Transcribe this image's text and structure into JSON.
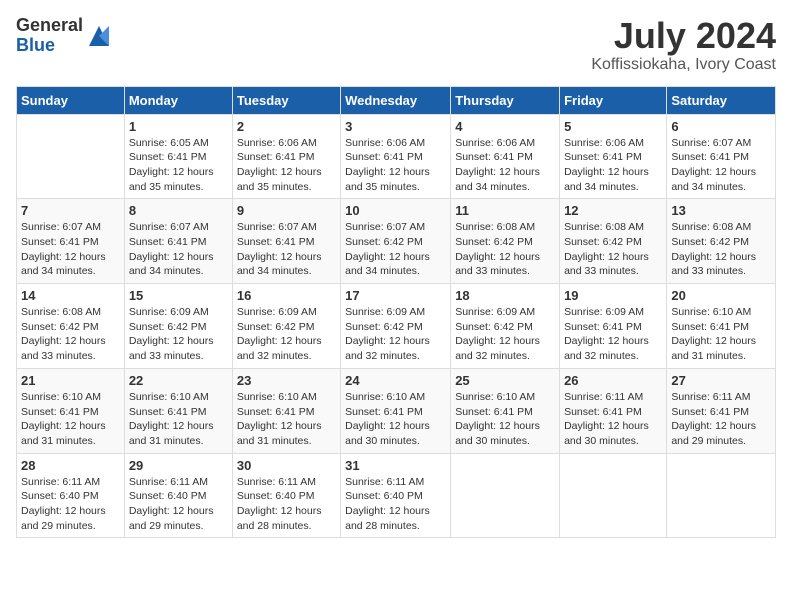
{
  "logo": {
    "general": "General",
    "blue": "Blue"
  },
  "title": {
    "month_year": "July 2024",
    "location": "Koffissiokaha, Ivory Coast"
  },
  "days_header": [
    "Sunday",
    "Monday",
    "Tuesday",
    "Wednesday",
    "Thursday",
    "Friday",
    "Saturday"
  ],
  "weeks": [
    [
      {
        "day": "",
        "sunrise": "",
        "sunset": "",
        "daylight": ""
      },
      {
        "day": "1",
        "sunrise": "Sunrise: 6:05 AM",
        "sunset": "Sunset: 6:41 PM",
        "daylight": "Daylight: 12 hours and 35 minutes."
      },
      {
        "day": "2",
        "sunrise": "Sunrise: 6:06 AM",
        "sunset": "Sunset: 6:41 PM",
        "daylight": "Daylight: 12 hours and 35 minutes."
      },
      {
        "day": "3",
        "sunrise": "Sunrise: 6:06 AM",
        "sunset": "Sunset: 6:41 PM",
        "daylight": "Daylight: 12 hours and 35 minutes."
      },
      {
        "day": "4",
        "sunrise": "Sunrise: 6:06 AM",
        "sunset": "Sunset: 6:41 PM",
        "daylight": "Daylight: 12 hours and 34 minutes."
      },
      {
        "day": "5",
        "sunrise": "Sunrise: 6:06 AM",
        "sunset": "Sunset: 6:41 PM",
        "daylight": "Daylight: 12 hours and 34 minutes."
      },
      {
        "day": "6",
        "sunrise": "Sunrise: 6:07 AM",
        "sunset": "Sunset: 6:41 PM",
        "daylight": "Daylight: 12 hours and 34 minutes."
      }
    ],
    [
      {
        "day": "7",
        "sunrise": "Sunrise: 6:07 AM",
        "sunset": "Sunset: 6:41 PM",
        "daylight": "Daylight: 12 hours and 34 minutes."
      },
      {
        "day": "8",
        "sunrise": "Sunrise: 6:07 AM",
        "sunset": "Sunset: 6:41 PM",
        "daylight": "Daylight: 12 hours and 34 minutes."
      },
      {
        "day": "9",
        "sunrise": "Sunrise: 6:07 AM",
        "sunset": "Sunset: 6:41 PM",
        "daylight": "Daylight: 12 hours and 34 minutes."
      },
      {
        "day": "10",
        "sunrise": "Sunrise: 6:07 AM",
        "sunset": "Sunset: 6:42 PM",
        "daylight": "Daylight: 12 hours and 34 minutes."
      },
      {
        "day": "11",
        "sunrise": "Sunrise: 6:08 AM",
        "sunset": "Sunset: 6:42 PM",
        "daylight": "Daylight: 12 hours and 33 minutes."
      },
      {
        "day": "12",
        "sunrise": "Sunrise: 6:08 AM",
        "sunset": "Sunset: 6:42 PM",
        "daylight": "Daylight: 12 hours and 33 minutes."
      },
      {
        "day": "13",
        "sunrise": "Sunrise: 6:08 AM",
        "sunset": "Sunset: 6:42 PM",
        "daylight": "Daylight: 12 hours and 33 minutes."
      }
    ],
    [
      {
        "day": "14",
        "sunrise": "Sunrise: 6:08 AM",
        "sunset": "Sunset: 6:42 PM",
        "daylight": "Daylight: 12 hours and 33 minutes."
      },
      {
        "day": "15",
        "sunrise": "Sunrise: 6:09 AM",
        "sunset": "Sunset: 6:42 PM",
        "daylight": "Daylight: 12 hours and 33 minutes."
      },
      {
        "day": "16",
        "sunrise": "Sunrise: 6:09 AM",
        "sunset": "Sunset: 6:42 PM",
        "daylight": "Daylight: 12 hours and 32 minutes."
      },
      {
        "day": "17",
        "sunrise": "Sunrise: 6:09 AM",
        "sunset": "Sunset: 6:42 PM",
        "daylight": "Daylight: 12 hours and 32 minutes."
      },
      {
        "day": "18",
        "sunrise": "Sunrise: 6:09 AM",
        "sunset": "Sunset: 6:42 PM",
        "daylight": "Daylight: 12 hours and 32 minutes."
      },
      {
        "day": "19",
        "sunrise": "Sunrise: 6:09 AM",
        "sunset": "Sunset: 6:41 PM",
        "daylight": "Daylight: 12 hours and 32 minutes."
      },
      {
        "day": "20",
        "sunrise": "Sunrise: 6:10 AM",
        "sunset": "Sunset: 6:41 PM",
        "daylight": "Daylight: 12 hours and 31 minutes."
      }
    ],
    [
      {
        "day": "21",
        "sunrise": "Sunrise: 6:10 AM",
        "sunset": "Sunset: 6:41 PM",
        "daylight": "Daylight: 12 hours and 31 minutes."
      },
      {
        "day": "22",
        "sunrise": "Sunrise: 6:10 AM",
        "sunset": "Sunset: 6:41 PM",
        "daylight": "Daylight: 12 hours and 31 minutes."
      },
      {
        "day": "23",
        "sunrise": "Sunrise: 6:10 AM",
        "sunset": "Sunset: 6:41 PM",
        "daylight": "Daylight: 12 hours and 31 minutes."
      },
      {
        "day": "24",
        "sunrise": "Sunrise: 6:10 AM",
        "sunset": "Sunset: 6:41 PM",
        "daylight": "Daylight: 12 hours and 30 minutes."
      },
      {
        "day": "25",
        "sunrise": "Sunrise: 6:10 AM",
        "sunset": "Sunset: 6:41 PM",
        "daylight": "Daylight: 12 hours and 30 minutes."
      },
      {
        "day": "26",
        "sunrise": "Sunrise: 6:11 AM",
        "sunset": "Sunset: 6:41 PM",
        "daylight": "Daylight: 12 hours and 30 minutes."
      },
      {
        "day": "27",
        "sunrise": "Sunrise: 6:11 AM",
        "sunset": "Sunset: 6:41 PM",
        "daylight": "Daylight: 12 hours and 29 minutes."
      }
    ],
    [
      {
        "day": "28",
        "sunrise": "Sunrise: 6:11 AM",
        "sunset": "Sunset: 6:40 PM",
        "daylight": "Daylight: 12 hours and 29 minutes."
      },
      {
        "day": "29",
        "sunrise": "Sunrise: 6:11 AM",
        "sunset": "Sunset: 6:40 PM",
        "daylight": "Daylight: 12 hours and 29 minutes."
      },
      {
        "day": "30",
        "sunrise": "Sunrise: 6:11 AM",
        "sunset": "Sunset: 6:40 PM",
        "daylight": "Daylight: 12 hours and 28 minutes."
      },
      {
        "day": "31",
        "sunrise": "Sunrise: 6:11 AM",
        "sunset": "Sunset: 6:40 PM",
        "daylight": "Daylight: 12 hours and 28 minutes."
      },
      {
        "day": "",
        "sunrise": "",
        "sunset": "",
        "daylight": ""
      },
      {
        "day": "",
        "sunrise": "",
        "sunset": "",
        "daylight": ""
      },
      {
        "day": "",
        "sunrise": "",
        "sunset": "",
        "daylight": ""
      }
    ]
  ]
}
